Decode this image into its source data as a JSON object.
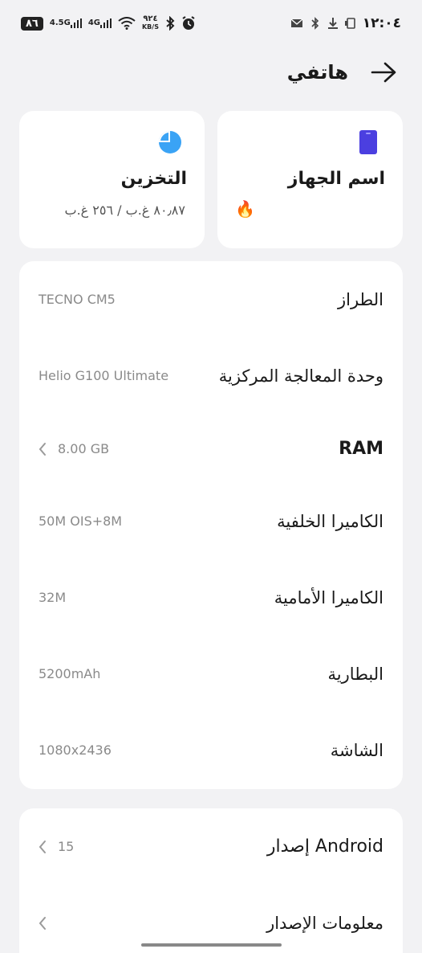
{
  "status": {
    "time": "١٢:٠٤",
    "battery": "٨٦",
    "signal1_label": "4.5G",
    "signal2_label": "4G",
    "speed_value": "٩٢٤",
    "speed_unit": "KB/S"
  },
  "header": {
    "title": "هاتفي"
  },
  "cards": {
    "device": {
      "title": "اسم الجهاز",
      "emoji": "🔥",
      "icon_color": "#4b3fe0"
    },
    "storage": {
      "title": "التخزين",
      "usage": "٨٠٫٨٧ غ.ب / ٢٥٦ غ.ب",
      "icon_color": "#3aa3f5"
    }
  },
  "specs": [
    {
      "label": "الطراز",
      "value": "TECNO CM5"
    },
    {
      "label": "وحدة المعالجة المركزية",
      "value": "Helio G100 Ultimate"
    },
    {
      "label": "RAM",
      "value": "8.00 GB"
    },
    {
      "label": "الكاميرا الخلفية",
      "value": "50M OIS+8M"
    },
    {
      "label": "الكاميرا الأمامية",
      "value": "32M"
    },
    {
      "label": "البطارية",
      "value": "5200mAh"
    },
    {
      "label": "الشاشة",
      "value": "1080x2436"
    }
  ],
  "about": [
    {
      "label": "إصدار Android",
      "value": "15"
    },
    {
      "label": "معلومات الإصدار",
      "value": ""
    }
  ]
}
